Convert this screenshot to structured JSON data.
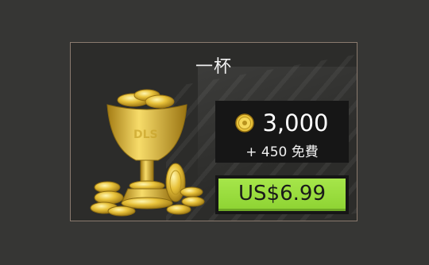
{
  "offer": {
    "title": "一杯",
    "trophy_watermark": "DLS",
    "coins_amount": "3,000",
    "bonus": "+ 450 免費",
    "price": "US$6.99"
  },
  "icons": {
    "coin": "coin-icon",
    "trophy": "trophy-icon"
  },
  "colors": {
    "background": "#363634",
    "card_border": "#8a7a6e",
    "price_button": "#9bdc3c",
    "gold": "#e8c23a"
  }
}
